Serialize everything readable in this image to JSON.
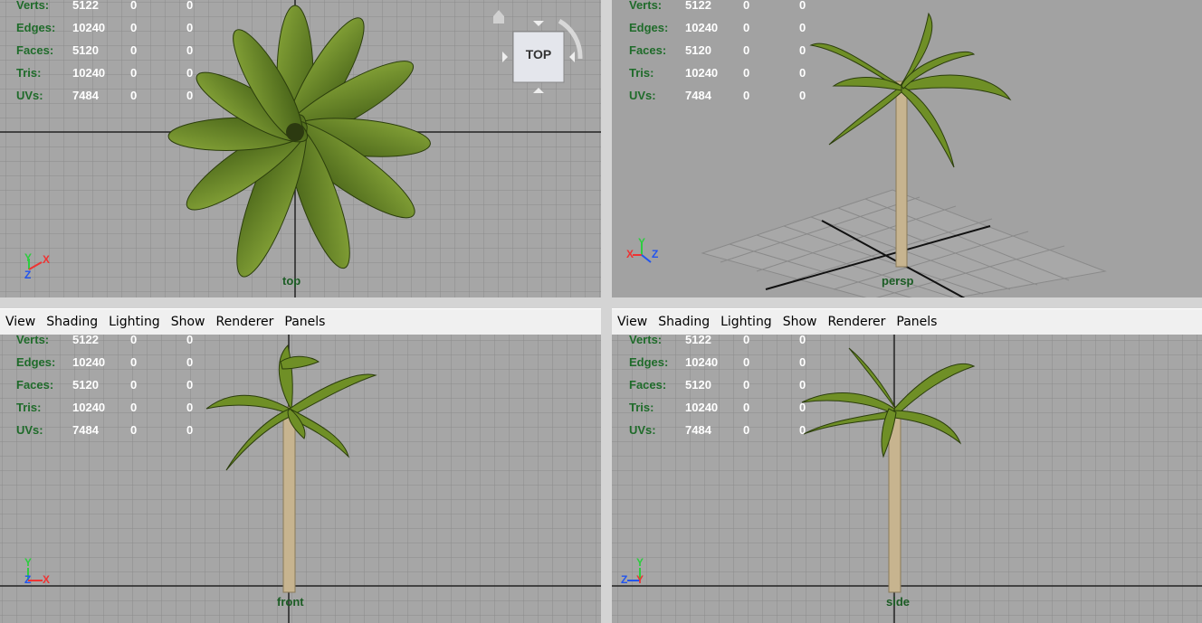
{
  "stats_labels": {
    "verts": "Verts:",
    "edges": "Edges:",
    "faces": "Faces:",
    "tris": "Tris:",
    "uvs": "UVs:"
  },
  "stats_values": {
    "verts": [
      "5122",
      "0",
      "0"
    ],
    "edges": [
      "10240",
      "0",
      "0"
    ],
    "faces": [
      "5120",
      "0",
      "0"
    ],
    "tris": [
      "10240",
      "0",
      "0"
    ],
    "uvs": [
      "7484",
      "0",
      "0"
    ]
  },
  "menu": {
    "view": "View",
    "shading": "Shading",
    "lighting": "Lighting",
    "show": "Show",
    "renderer": "Renderer",
    "panels": "Panels"
  },
  "viewports": {
    "top": {
      "label": "top"
    },
    "persp": {
      "label": "persp"
    },
    "front": {
      "label": "front"
    },
    "side": {
      "label": "side"
    }
  },
  "viewcube": {
    "face": "TOP"
  },
  "axes": {
    "x": "X",
    "y": "Y",
    "z": "Z"
  },
  "colors": {
    "viewport_bg": "#a6a6a6",
    "persp_bg": "#a2a2a2",
    "grid": "#8c8c8c",
    "axis_line": "#222222",
    "label_green": "#1b5c24",
    "stat_label": "#1f6b2a",
    "leaf": "#6f8f26",
    "trunk": "#c7b48f"
  }
}
